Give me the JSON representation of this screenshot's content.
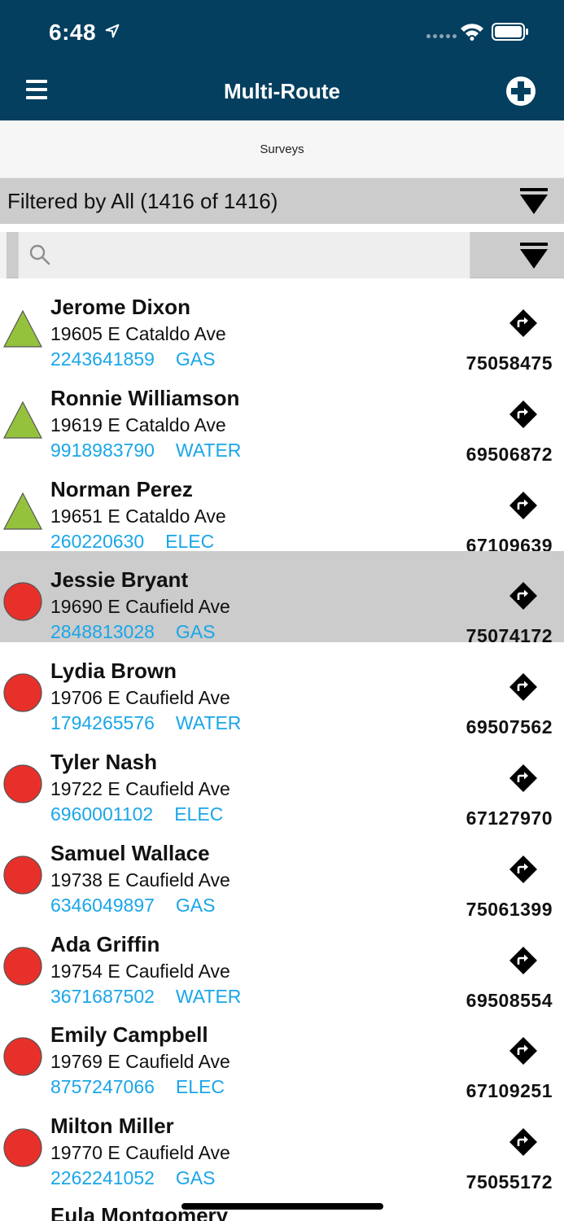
{
  "status_bar": {
    "time": "6:48"
  },
  "header": {
    "title": "Multi-Route"
  },
  "segment": {
    "label": "Surveys"
  },
  "filter": {
    "text": "Filtered by All (1416 of 1416)"
  },
  "search": {
    "placeholder": "",
    "value": ""
  },
  "colors": {
    "header_bg": "#043f5f",
    "accent_blue": "#1aa6e8",
    "status_green": "#95c23d",
    "status_red": "#e8302a",
    "selected_row": "#cccccc"
  },
  "rows": [
    {
      "name": "Jerome Dixon",
      "address": "19605 E Cataldo Ave",
      "account": "2243641859",
      "service": "GAS",
      "route": "75058475",
      "status": "triangle-green"
    },
    {
      "name": "Ronnie Williamson",
      "address": "19619 E Cataldo Ave",
      "account": "9918983790",
      "service": "WATER",
      "route": "69506872",
      "status": "triangle-green"
    },
    {
      "name": "Norman Perez",
      "address": "19651 E Cataldo Ave",
      "account": "260220630",
      "service": "ELEC",
      "route": "67109639",
      "status": "triangle-green"
    },
    {
      "name": "Jessie Bryant",
      "address": "19690 E Caufield Ave",
      "account": "2848813028",
      "service": "GAS",
      "route": "75074172",
      "status": "circle-red"
    },
    {
      "name": "Lydia Brown",
      "address": "19706 E Caufield Ave",
      "account": "1794265576",
      "service": "WATER",
      "route": "69507562",
      "status": "circle-red"
    },
    {
      "name": "Tyler Nash",
      "address": "19722 E Caufield Ave",
      "account": "6960001102",
      "service": "ELEC",
      "route": "67127970",
      "status": "circle-red"
    },
    {
      "name": "Samuel Wallace",
      "address": "19738 E Caufield Ave",
      "account": "6346049897",
      "service": "GAS",
      "route": "75061399",
      "status": "circle-red"
    },
    {
      "name": "Ada Griffin",
      "address": "19754 E Caufield Ave",
      "account": "3671687502",
      "service": "WATER",
      "route": "69508554",
      "status": "circle-red"
    },
    {
      "name": "Emily Campbell",
      "address": "19769 E Caufield Ave",
      "account": "8757247066",
      "service": "ELEC",
      "route": "67109251",
      "status": "circle-red"
    },
    {
      "name": "Milton Miller",
      "address": "19770 E Caufield Ave",
      "account": "2262241052",
      "service": "GAS",
      "route": "75055172",
      "status": "circle-red"
    },
    {
      "name": "Eula Montgomery"
    }
  ]
}
